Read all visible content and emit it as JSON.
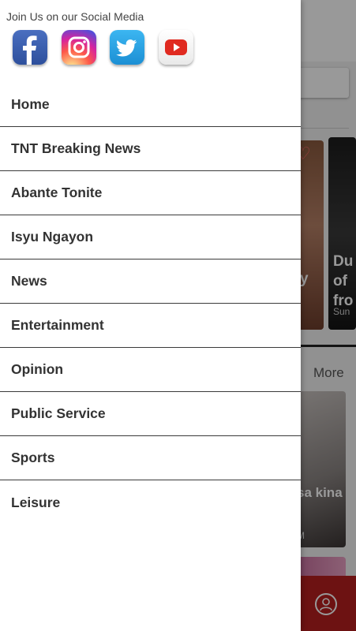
{
  "background": {
    "card_b_title": "Du of fro",
    "card_b_meta": "Sun",
    "card_a_title": "y",
    "more_label": "More",
    "card_c_title": "sa kina",
    "card_c_meta": "M"
  },
  "drawer": {
    "social_title": "Join Us on our Social Media",
    "social_icons": [
      "facebook-icon",
      "instagram-icon",
      "twitter-icon",
      "youtube-icon"
    ],
    "menu": [
      {
        "label": "Home"
      },
      {
        "label": "TNT Breaking News"
      },
      {
        "label": "Abante Tonite"
      },
      {
        "label": "Isyu Ngayon"
      },
      {
        "label": "News"
      },
      {
        "label": "Entertainment"
      },
      {
        "label": "Opinion"
      },
      {
        "label": "Public Service"
      },
      {
        "label": "Sports"
      },
      {
        "label": "Leisure"
      }
    ]
  },
  "colors": {
    "accent_red": "#b61e1e",
    "menu_text": "#333333",
    "divider": "#3a3a3a"
  }
}
